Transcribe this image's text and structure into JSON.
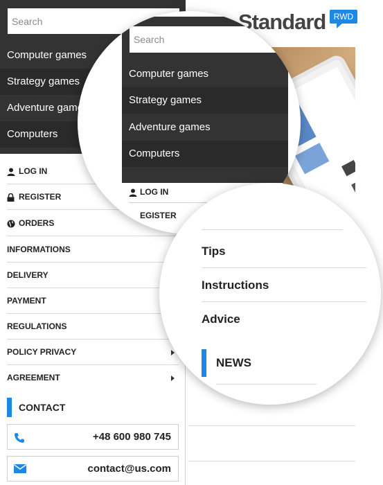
{
  "logo": {
    "word": "Standard",
    "badge": "RWD"
  },
  "search": {
    "placeholder": "Search"
  },
  "categories": [
    {
      "label": "Computer games"
    },
    {
      "label": "Strategy games"
    },
    {
      "label": "Adventure games"
    },
    {
      "label": "Computers"
    }
  ],
  "account_links": [
    {
      "label": "LOG IN",
      "icon": "user-icon"
    },
    {
      "label": "REGISTER",
      "icon": "lock-icon"
    },
    {
      "label": "ORDERS",
      "icon": "globe-icon"
    }
  ],
  "info_links": [
    {
      "label": "INFORMATIONS"
    },
    {
      "label": "DELIVERY"
    },
    {
      "label": "PAYMENT"
    },
    {
      "label": "REGULATIONS"
    },
    {
      "label": "POLICY PRIVACY",
      "has_submenu": true
    },
    {
      "label": "AGREEMENT",
      "has_submenu": true
    }
  ],
  "contact": {
    "heading": "CONTACT",
    "phone": "+48 600 980 745",
    "email": "contact@us.com"
  },
  "magnified_top": {
    "login": "LOG IN",
    "register_partial": "EGISTER"
  },
  "magnified_bottom": {
    "menu": [
      {
        "label": "Tips"
      },
      {
        "label": "Instructions"
      },
      {
        "label": "Advice"
      }
    ],
    "news_heading": "NEWS"
  },
  "colors": {
    "accent": "#1e88e5",
    "dark_panel": "#333333",
    "dark_panel_alt": "#2a2a2a"
  }
}
